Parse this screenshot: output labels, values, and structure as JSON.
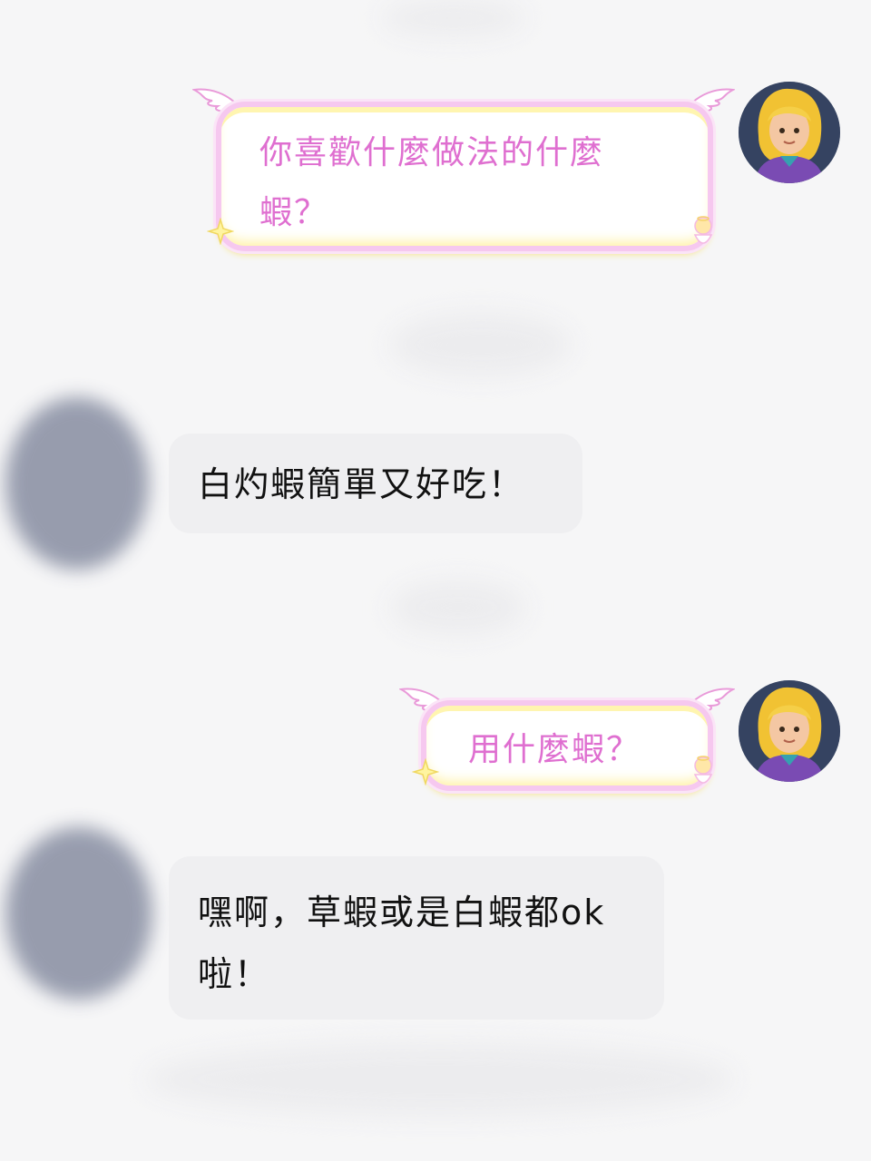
{
  "messages": [
    {
      "side": "outgoing",
      "text": "你喜歡什麼做法的什麼蝦？"
    },
    {
      "side": "incoming",
      "text": "白灼蝦簡單又好吃！"
    },
    {
      "side": "outgoing",
      "text": "用什麼蝦？"
    },
    {
      "side": "incoming",
      "text": "嘿啊，草蝦或是白蝦都ok啦！"
    }
  ],
  "colors": {
    "background": "#f6f6f7",
    "outgoing_text": "#df6fd0",
    "outgoing_border": "#f6c8ef",
    "outgoing_glow": "#fff3a6",
    "incoming_bubble": "#efeff1",
    "incoming_text": "#111111"
  },
  "icons": [
    "angel-wing-icon",
    "angel-figure-icon",
    "sparkle-icon",
    "user-avatar",
    "blurred-avatar"
  ]
}
